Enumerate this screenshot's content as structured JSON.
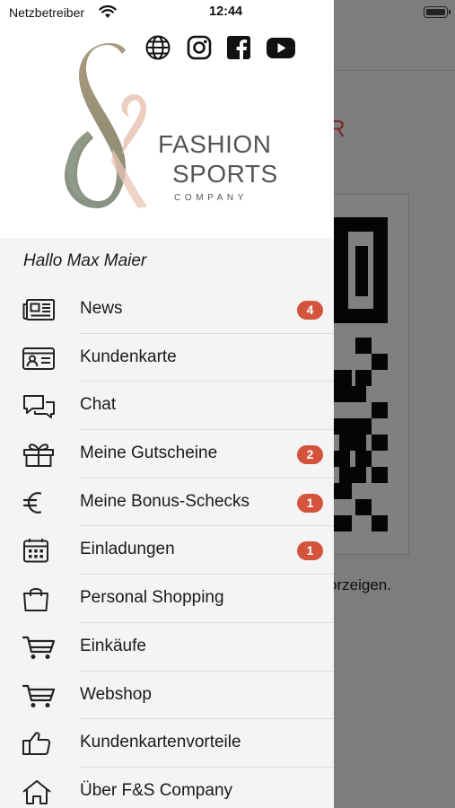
{
  "status_bar": {
    "carrier": "Netzbetreiber",
    "time": "12:44"
  },
  "background": {
    "red_text": "R",
    "instruction_text": "orzeigen."
  },
  "header": {
    "brand_line1": "FASHION",
    "brand_line2": "SPORTS",
    "brand_line3": "COMPANY",
    "social_icons": [
      "globe-icon",
      "instagram-icon",
      "facebook-icon",
      "youtube-icon"
    ]
  },
  "greeting": "Hallo Max Maier",
  "menu": {
    "items": [
      {
        "label": "News",
        "icon": "newspaper-icon",
        "badge": "4"
      },
      {
        "label": "Kundenkarte",
        "icon": "id-card-icon",
        "badge": ""
      },
      {
        "label": "Chat",
        "icon": "chat-icon",
        "badge": ""
      },
      {
        "label": "Meine Gutscheine",
        "icon": "gift-icon",
        "badge": "2"
      },
      {
        "label": "Meine Bonus-Schecks",
        "icon": "euro-icon",
        "badge": "1"
      },
      {
        "label": "Einladungen",
        "icon": "calendar-icon",
        "badge": "1"
      },
      {
        "label": "Personal Shopping",
        "icon": "shopping-bag-icon",
        "badge": ""
      },
      {
        "label": "Einkäufe",
        "icon": "cart-icon",
        "badge": ""
      },
      {
        "label": "Webshop",
        "icon": "cart-icon",
        "badge": ""
      },
      {
        "label": "Kundenkartenvorteile",
        "icon": "thumbs-up-icon",
        "badge": ""
      },
      {
        "label": "Über F&S Company",
        "icon": "home-icon",
        "badge": ""
      }
    ]
  },
  "colors": {
    "badge": "#d4533d",
    "brand_text": "#555555",
    "logo_green": "#8f9a8a",
    "logo_peach": "#e8c6b4"
  }
}
